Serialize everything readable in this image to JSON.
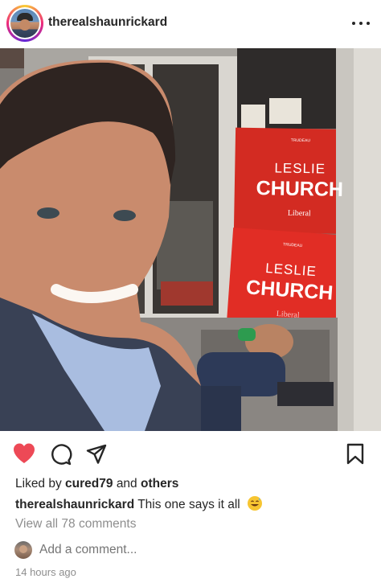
{
  "post": {
    "username": "therealshaunrickard",
    "more_icon": "more-horizontal-icon"
  },
  "photo": {
    "signs": [
      {
        "small": "TRUDEAU",
        "first": "LESLIE",
        "last": "CHURCH",
        "party": "Liberal"
      },
      {
        "small": "TRUDEAU",
        "first": "LESLIE",
        "last": "CHURCH",
        "party": "Liberal"
      }
    ]
  },
  "actions": {
    "like_icon": "heart-filled-icon",
    "comment_icon": "comment-icon",
    "share_icon": "paper-plane-icon",
    "save_icon": "bookmark-icon",
    "like_color": "#ed4956"
  },
  "likes": {
    "prefix": "Liked by",
    "user": "cured79",
    "middle": "and",
    "others": "others"
  },
  "caption": {
    "username": "therealshaunrickard",
    "text": "This one says it all",
    "emoji": "grinning-face-with-sweat-emoji"
  },
  "comments": {
    "view_all": "View all 78 comments",
    "placeholder": "Add a comment..."
  },
  "timestamp": "14 hours ago"
}
